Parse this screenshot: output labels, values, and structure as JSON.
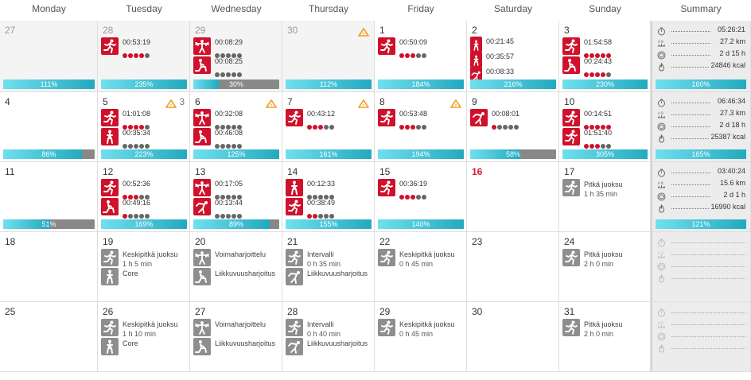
{
  "headers": [
    "Monday",
    "Tuesday",
    "Wednesday",
    "Thursday",
    "Friday",
    "Saturday",
    "Sunday",
    "Summary"
  ],
  "colors": {
    "accent_red": "#d0112b",
    "bar_start": "#6fe0ef",
    "bar_end": "#23a9bf",
    "bar_bg": "#888888",
    "today_red": "#d8202b"
  },
  "weeks": [
    {
      "days": [
        {
          "num": "27",
          "muted": true,
          "past": true,
          "workouts": [],
          "bar": {
            "label": "111%",
            "fill": 1.0
          }
        },
        {
          "num": "28",
          "muted": true,
          "past": true,
          "workouts": [
            {
              "icon": "run-icon",
              "time": "00:53:19",
              "intensity": 4
            }
          ],
          "bar": {
            "label": "235%",
            "fill": 1.0
          }
        },
        {
          "num": "29",
          "muted": true,
          "past": true,
          "workouts": [
            {
              "icon": "weights-icon",
              "time": "00:08:29",
              "intensity": 0
            },
            {
              "icon": "mobility-icon",
              "time": "00:08:25",
              "intensity": 0
            }
          ],
          "bar": {
            "label": "30%",
            "fill": 0.3
          }
        },
        {
          "num": "30",
          "muted": true,
          "past": true,
          "warning": true,
          "workouts": [],
          "bar": {
            "label": "112%",
            "fill": 1.0
          }
        },
        {
          "num": "1",
          "workouts": [
            {
              "icon": "run-icon",
              "time": "00:50:09",
              "intensity": 3
            }
          ],
          "bar": {
            "label": "184%",
            "fill": 1.0
          }
        },
        {
          "num": "2",
          "workouts": [
            {
              "icon": "core-icon",
              "time": "00:21:45",
              "intensity": 0,
              "small": true
            },
            {
              "icon": "core-icon",
              "time": "00:35:57",
              "intensity": 0,
              "small": true
            },
            {
              "icon": "stretch-icon",
              "time": "00:08:33",
              "intensity": 0,
              "small": true
            }
          ],
          "bar": {
            "label": "216%",
            "fill": 1.0
          }
        },
        {
          "num": "3",
          "workouts": [
            {
              "icon": "run-icon",
              "time": "01:54:58",
              "intensity": 5
            },
            {
              "icon": "mobility-icon",
              "time": "00:24:43",
              "intensity": 4
            }
          ],
          "bar": {
            "label": "230%",
            "fill": 1.0
          }
        }
      ],
      "summary": {
        "duration": "05:26:21",
        "distance": "27.2 km",
        "recovery": "2 d 15 h",
        "calories": "24846 kcal",
        "bar": {
          "label": "160%",
          "fill": 1.0
        }
      }
    },
    {
      "days": [
        {
          "num": "4",
          "workouts": [],
          "bar": {
            "label": "86%",
            "fill": 0.86
          }
        },
        {
          "num": "5",
          "warning": true,
          "warning_count": "3",
          "workouts": [
            {
              "icon": "run-icon",
              "time": "01:01:08",
              "intensity": 4
            },
            {
              "icon": "core-icon",
              "time": "00:35:34",
              "intensity": 0
            }
          ],
          "bar": {
            "label": "223%",
            "fill": 1.0
          }
        },
        {
          "num": "6",
          "warning": true,
          "workouts": [
            {
              "icon": "weights-icon",
              "time": "00:32:08",
              "intensity": 0
            },
            {
              "icon": "mobility-icon",
              "time": "00:46:08",
              "intensity": 0
            }
          ],
          "bar": {
            "label": "125%",
            "fill": 1.0
          }
        },
        {
          "num": "7",
          "warning": true,
          "workouts": [
            {
              "icon": "run-icon",
              "time": "00:43:12",
              "intensity": 3
            }
          ],
          "bar": {
            "label": "161%",
            "fill": 1.0
          }
        },
        {
          "num": "8",
          "warning": true,
          "workouts": [
            {
              "icon": "run-icon",
              "time": "00:53:48",
              "intensity": 3
            }
          ],
          "bar": {
            "label": "194%",
            "fill": 1.0
          }
        },
        {
          "num": "9",
          "workouts": [
            {
              "icon": "stretch-icon",
              "time": "00:08:01",
              "intensity": 1
            }
          ],
          "bar": {
            "label": "58%",
            "fill": 0.58
          }
        },
        {
          "num": "10",
          "workouts": [
            {
              "icon": "run-icon",
              "time": "00:14:51",
              "intensity": 5
            },
            {
              "icon": "run-icon",
              "time": "01:51:40",
              "intensity": 3
            }
          ],
          "bar": {
            "label": "305%",
            "fill": 1.0
          }
        }
      ],
      "summary": {
        "duration": "06:46:34",
        "distance": "27.3 km",
        "recovery": "2 d 18 h",
        "calories": "25387 kcal",
        "bar": {
          "label": "165%",
          "fill": 1.0
        }
      }
    },
    {
      "days": [
        {
          "num": "11",
          "workouts": [],
          "bar": {
            "label": "51%",
            "fill": 0.51
          }
        },
        {
          "num": "12",
          "workouts": [
            {
              "icon": "run-icon",
              "time": "00:52:36",
              "intensity": 3
            },
            {
              "icon": "mobility-icon",
              "time": "00:49:16",
              "intensity": 1
            }
          ],
          "bar": {
            "label": "169%",
            "fill": 1.0
          }
        },
        {
          "num": "13",
          "workouts": [
            {
              "icon": "weights-icon",
              "time": "00:17:05",
              "intensity": 0
            },
            {
              "icon": "stretch-icon",
              "time": "00:13:44",
              "intensity": 0
            }
          ],
          "bar": {
            "label": "89%",
            "fill": 0.89
          }
        },
        {
          "num": "14",
          "workouts": [
            {
              "icon": "core-icon",
              "time": "00:12:33",
              "intensity": 0
            },
            {
              "icon": "run-icon",
              "time": "00:38:49",
              "intensity": 2
            }
          ],
          "bar": {
            "label": "155%",
            "fill": 1.0
          }
        },
        {
          "num": "15",
          "workouts": [
            {
              "icon": "run-icon",
              "time": "00:36:19",
              "intensity": 3
            }
          ],
          "bar": {
            "label": "140%",
            "fill": 1.0
          }
        },
        {
          "num": "16",
          "today": true,
          "workouts": []
        },
        {
          "num": "17",
          "planned": [
            {
              "icon": "run-icon",
              "name": "Pitkä juoksu",
              "dur": "1 h 35 min"
            }
          ]
        }
      ],
      "summary": {
        "duration": "03:40:24",
        "distance": "15.6 km",
        "recovery": "2 d 1 h",
        "calories": "16990 kcal",
        "bar": {
          "label": "121%",
          "fill": 1.0
        }
      }
    },
    {
      "days": [
        {
          "num": "18"
        },
        {
          "num": "19",
          "planned": [
            {
              "icon": "run-icon",
              "name": "Keskipitkä juoksu",
              "dur": "1 h 5 min"
            },
            {
              "icon": "core-icon",
              "name": "Core",
              "dur": ""
            }
          ]
        },
        {
          "num": "20",
          "planned": [
            {
              "icon": "weights-icon",
              "name": "Voimaharjoittelu",
              "dur": ""
            },
            {
              "icon": "mobility-icon",
              "name": "Liikkuvuusharjoitus",
              "dur": ""
            }
          ]
        },
        {
          "num": "21",
          "planned": [
            {
              "icon": "run-icon",
              "name": "Intervalli",
              "dur": "0 h 35 min"
            },
            {
              "icon": "stretch-icon",
              "name": "Liikkuvuusharjoitus",
              "dur": ""
            }
          ]
        },
        {
          "num": "22",
          "planned": [
            {
              "icon": "run-icon",
              "name": "Keskipitkä juoksu",
              "dur": "0 h 45 min"
            }
          ]
        },
        {
          "num": "23"
        },
        {
          "num": "24",
          "planned": [
            {
              "icon": "run-icon",
              "name": "Pitkä juoksu",
              "dur": "2 h 0 min"
            }
          ]
        }
      ],
      "summary": null
    },
    {
      "days": [
        {
          "num": "25"
        },
        {
          "num": "26",
          "planned": [
            {
              "icon": "run-icon",
              "name": "Keskipitkä juoksu",
              "dur": "1 h 10 min"
            },
            {
              "icon": "core-icon",
              "name": "Core",
              "dur": ""
            }
          ]
        },
        {
          "num": "27",
          "planned": [
            {
              "icon": "weights-icon",
              "name": "Voimaharjoittelu",
              "dur": ""
            },
            {
              "icon": "mobility-icon",
              "name": "Liikkuvuusharjoitus",
              "dur": ""
            }
          ]
        },
        {
          "num": "28",
          "planned": [
            {
              "icon": "run-icon",
              "name": "Intervalli",
              "dur": "0 h 40 min"
            },
            {
              "icon": "stretch-icon",
              "name": "Liikkuvuusharjoitus",
              "dur": ""
            }
          ]
        },
        {
          "num": "29",
          "planned": [
            {
              "icon": "run-icon",
              "name": "Keskipitkä juoksu",
              "dur": "0 h 45 min"
            }
          ]
        },
        {
          "num": "30"
        },
        {
          "num": "31",
          "planned": [
            {
              "icon": "run-icon",
              "name": "Pitkä juoksu",
              "dur": "2 h 0 min"
            }
          ]
        }
      ],
      "summary": null
    }
  ]
}
